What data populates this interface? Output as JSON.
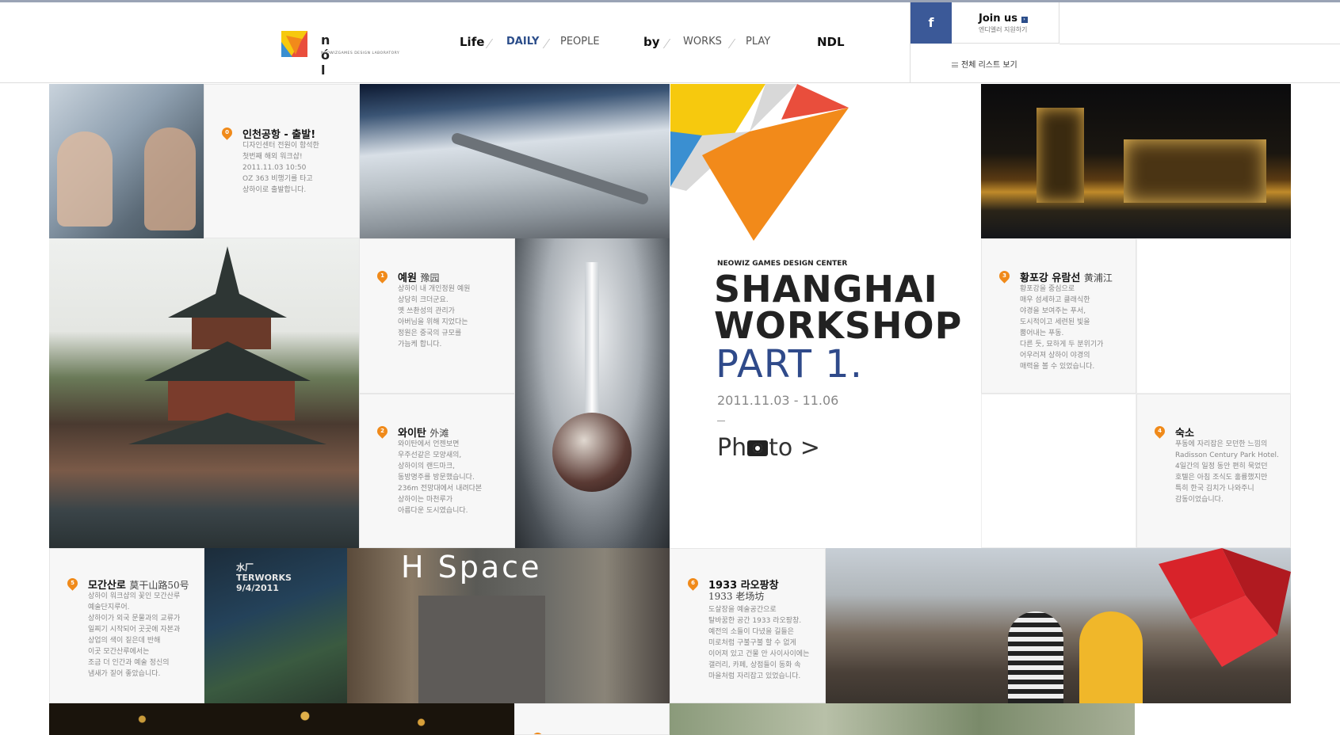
{
  "header": {
    "logo_letters": "n ó l",
    "logo_sub": "NEOWIZGAMES DESIGN LABORATORY",
    "nav": {
      "life": "Life",
      "daily": "DAILY",
      "people": "PEOPLE",
      "by": "by",
      "works": "WORKS",
      "play": "PLAY",
      "ndl": "NDL"
    },
    "facebook_label": "f",
    "join_title": "Join us",
    "join_sub": "엔디엘러 지원하기",
    "list_link": "전체 리스트 보기"
  },
  "feature": {
    "sub": "NEOWIZ GAMES DESIGN CENTER",
    "title_line1": "SHANGHAI",
    "title_line2": "WORKSHOP",
    "part": "PART 1.",
    "date": "2011.11.03 - 11.06",
    "photo_label_pre": "Ph",
    "photo_label_post": "to >"
  },
  "posts": [
    {
      "num": "0",
      "title": "인천공항 - 출발!",
      "cn": "",
      "body": "디자인센터 전원이 함석한\n첫번째 해외 워크샵!\n2011.11.03 10:50\nOZ 363 비행기를 타고\n상하이로 출발합니다."
    },
    {
      "num": "1",
      "title": "예원",
      "cn": "豫园",
      "body": "상하이 내 개인정원 예원\n상당히 크더군요.\n옛 쓰촨성의 관리가\n아버님을 위해 지었다는\n정원은 중국의 규모를\n가늠케 합니다."
    },
    {
      "num": "2",
      "title": "와이탄",
      "cn": "外滩",
      "body": "와이탄에서 언젠보면\n우주선같은 모양새의,\n상하이의 랜드마크,\n동방명주를 방문했습니다.\n236m 전망대에서 내려다본\n상하이는 마천루가\n아름다운 도시였습니다."
    },
    {
      "num": "3",
      "title": "황포강 유람선",
      "cn": "黄浦江",
      "body": "황포강을 중심으로\n매우 섬세하고 클래식한\n야경을 보여주는 푸서,\n도시적이고 세련된 빛을\n뿜어내는 푸동.\n다른 듯, 묘하게 두 분위기가\n어우러져 상하이 야경의\n매력을 볼 수 있었습니다."
    },
    {
      "num": "4",
      "title": "숙소",
      "cn": "",
      "body": "푸동에 자리잡은 모던한 느낌의\nRadisson Century Park Hotel.\n4일간의 일정 동안 편히 묵었던\n호텔은 아침 조식도 훌륭했지만\n특히 한국 김치가 나와주니\n감동이었습니다."
    },
    {
      "num": "5",
      "title": "모간산로",
      "cn": "莫干山路50号",
      "body": "상하이 워크샵의 꽃인 모간산루\n예술단지루어.\n상하이가 외국 문물과의 교류가\n일찌기 시작되어 곳곳에 자본과\n상업의 색이 짙은데 반해\n이곳 모간산루에서는\n조금 더 인간과 예술 정신의\n냄새가 짙어 좋았습니다."
    },
    {
      "num": "6",
      "title": "1933 라오팡창",
      "cn": "1933 老场坊",
      "body": "도살장을 예술공간으로\n탈바꿈한 공간 1933 라오팡창.\n예전의 소들이 다녔을 길들은\n미로처럼 구불구불 할 수 없게\n이어져 있고 건물 안 사이사이에는\n갤러리, 카페, 상점들이 동화 속\n마을처럼 자리잡고 있었습니다."
    }
  ],
  "photo_texts": {
    "hspace": "H Space",
    "waterworks_sign": "水厂\nTERWORKS\n9/4/2011"
  },
  "colors": {
    "accent_blue": "#2f4a8a",
    "facebook": "#3b5998",
    "pin_orange": "#f08a1a"
  }
}
